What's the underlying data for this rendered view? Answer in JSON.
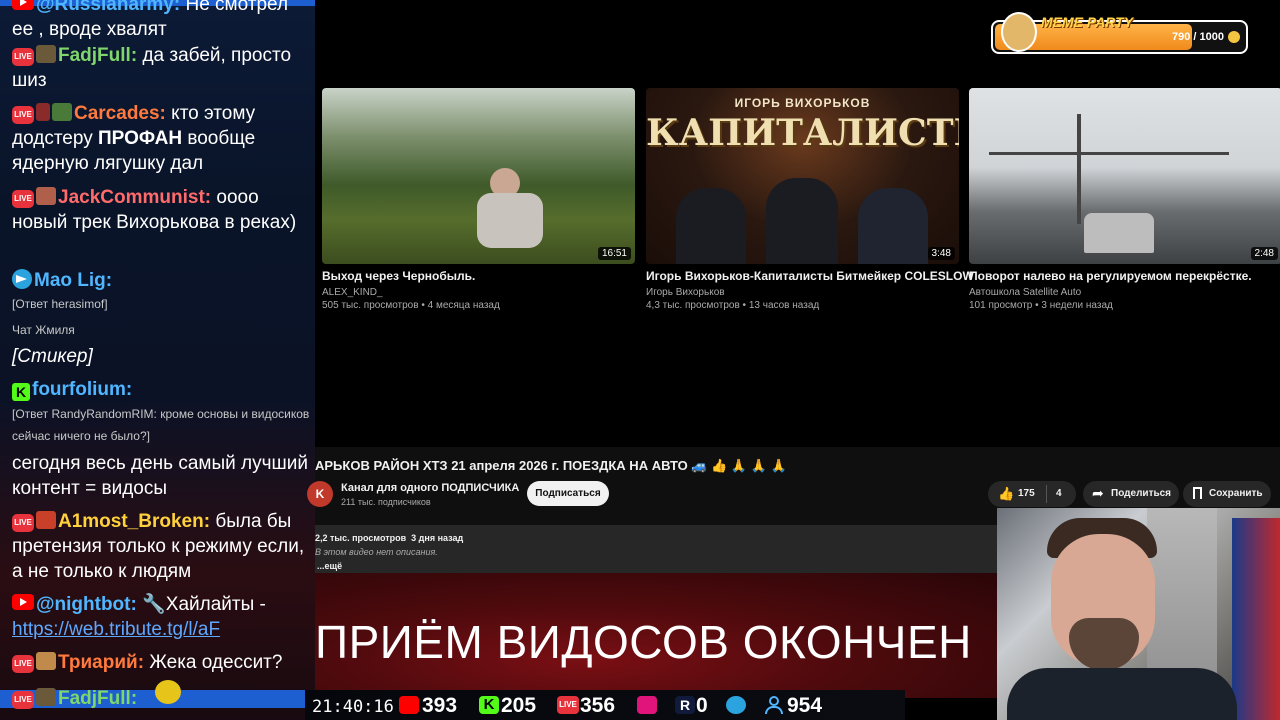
{
  "chat": {
    "messages": [
      {
        "author": "@Russianarmy:",
        "text": "Не смотрел ее , вроде хвалят",
        "author_color": "#4fb6ff"
      },
      {
        "author": "FadjFull:",
        "text": "да забей, просто шиз",
        "author_color": "#7fd66b"
      },
      {
        "author": "Carcades:",
        "text_pre": "кто этому додстеру ",
        "text_bold": "ПРОФАН",
        "text_post": "  вообще ядерную лягушку дал",
        "author_color": "#ff7a3c"
      },
      {
        "author": "JackCommunist:",
        "text": "оооо новый трек Вихорькова в реках)",
        "author_color": "#ff6b6b"
      },
      {
        "author": "Mao Lig:",
        "reply": "[Ответ herasimof]",
        "sub": "Чат Жмиля",
        "text": "[Стикер]",
        "author_color": "#4fb6ff"
      },
      {
        "author": "fourfolium:",
        "reply": "[Ответ RandyRandomRIM: кроме основы и видосиков сейчас ничего не было?]",
        "text": "сегодня весь день самый лучший контент = видосы",
        "author_color": "#4fb6ff"
      },
      {
        "author": "A1most_Broken:",
        "text": "была бы претензия только к режиму если, а не только к людям",
        "author_color": "#ffd13c"
      },
      {
        "author": "@nightbot:",
        "text": "Хайлайты - ",
        "link": "https://web.tribute.tg/l/aF",
        "author_color": "#4fb6ff"
      },
      {
        "author": "Триарий:",
        "text": "Жека одессит?",
        "author_color": "#ff7a3c"
      },
      {
        "author": "FadjFull:",
        "text": "",
        "author_color": "#7fd66b"
      }
    ],
    "badge_live": "LIVE"
  },
  "videos": [
    {
      "title": "Выход через Чернобыль.",
      "channel": "ALEX_KIND_",
      "stats": "505 тыс. просмотров • 4 месяца назад",
      "duration": "16:51"
    },
    {
      "title": "Игорь Вихорьков-Капиталисты Битмейкер COLESLOW",
      "channel": "Игорь Вихорьков",
      "stats": "4,3 тыс. просмотров • 13 часов назад",
      "duration": "3:48",
      "poster_top": "ИГОРЬ ВИХОРЬКОВ",
      "poster_main": "КАПИТАЛИСТЫ"
    },
    {
      "title": "Поворот налево на регулируемом перекрёстке.",
      "channel": "Автошкола Satellite Auto",
      "stats": "101 просмотр • 3 недели назад",
      "duration": "2:48"
    }
  ],
  "current": {
    "title": "АРЬКОВ РАЙОН ХТЗ 21 апреля 2026 г. ПОЕЗДКА НА АВТО 🚙 👍 🙏 🙏 🙏",
    "channel_initial": "K",
    "channel": "Канал для одного ПОДПИСЧИКА",
    "subs": "211 тыс. подписчиков",
    "subscribe": "Подписаться",
    "likes": "175",
    "dislikes": "4",
    "share": "Поделиться",
    "save": "Сохранить",
    "views": "2,2 тыс. просмотров  3 дня назад",
    "desc": "В этом видео нет описания.",
    "more": "...ещё"
  },
  "banner": "ПРИЁМ ВИДОСОВ ОКОНЧЕН",
  "meme": {
    "title": "MEME PARTY",
    "progress": "790 / 1000",
    "fill": 0.79
  },
  "stats": {
    "time": "21:40:16",
    "youtube": "393",
    "kick": "205",
    "live": "356",
    "rutube": "0",
    "telegram": "",
    "viewers": "954"
  },
  "colors": {
    "youtube": "#ff0000",
    "kick": "#53fc18",
    "live": "#e8323c",
    "telegram": "#2aa3df",
    "viewers": "#4fb6ff"
  }
}
